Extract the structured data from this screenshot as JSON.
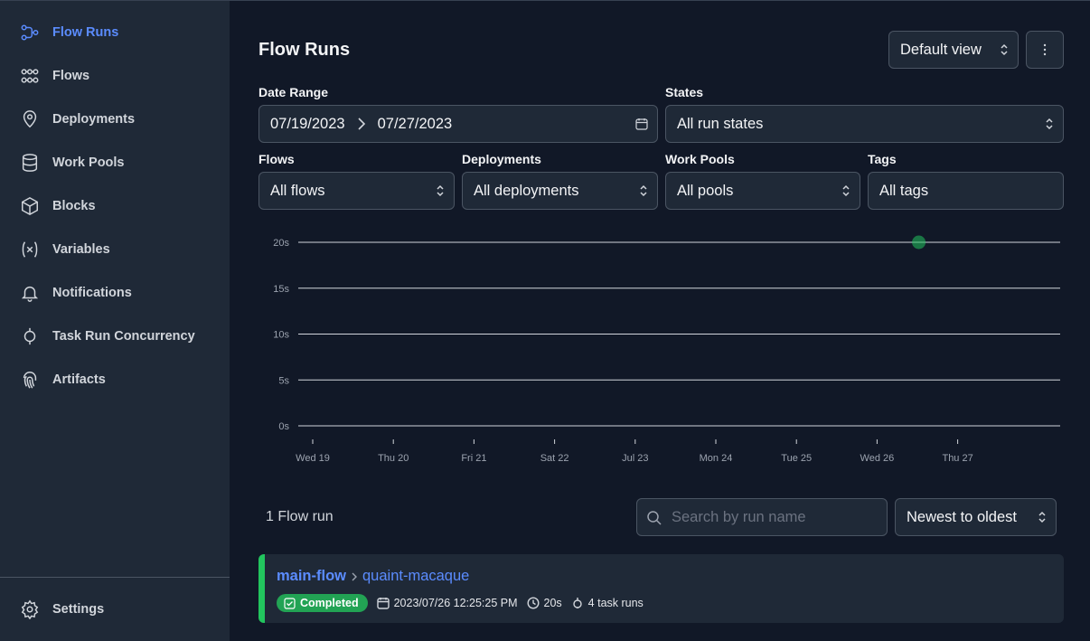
{
  "sidebar": {
    "items": [
      {
        "label": "Flow Runs",
        "icon": "flow-runs-icon",
        "active": true
      },
      {
        "label": "Flows",
        "icon": "flows-icon"
      },
      {
        "label": "Deployments",
        "icon": "map-pin-icon"
      },
      {
        "label": "Work Pools",
        "icon": "database-icon"
      },
      {
        "label": "Blocks",
        "icon": "cube-icon"
      },
      {
        "label": "Variables",
        "icon": "variable-icon"
      },
      {
        "label": "Notifications",
        "icon": "bell-icon"
      },
      {
        "label": "Task Run Concurrency",
        "icon": "concurrency-icon"
      },
      {
        "label": "Artifacts",
        "icon": "fingerprint-icon"
      }
    ],
    "settings_label": "Settings"
  },
  "header": {
    "title": "Flow Runs",
    "view_select": "Default view"
  },
  "filters": {
    "date_range": {
      "label": "Date Range",
      "start": "07/19/2023",
      "end": "07/27/2023"
    },
    "states": {
      "label": "States",
      "value": "All run states"
    },
    "flows": {
      "label": "Flows",
      "value": "All flows"
    },
    "deployments": {
      "label": "Deployments",
      "value": "All deployments"
    },
    "work_pools": {
      "label": "Work Pools",
      "value": "All pools"
    },
    "tags": {
      "label": "Tags",
      "value": "All tags"
    }
  },
  "chart_data": {
    "type": "scatter",
    "categories": [
      "Wed 19",
      "Thu 20",
      "Fri 21",
      "Sat 22",
      "Jul 23",
      "Mon 24",
      "Tue 25",
      "Wed 26",
      "Thu 27"
    ],
    "y_ticks": [
      "0s",
      "5s",
      "10s",
      "15s",
      "20s"
    ],
    "ylim": [
      0,
      20
    ],
    "points": [
      {
        "x": "2023-07-26 12:25:25",
        "y": 20,
        "state": "Completed"
      }
    ],
    "grid": true,
    "colors": {
      "completed": "#22c55e"
    }
  },
  "runs_list": {
    "count_text": "1 Flow run",
    "search_placeholder": "Search by run name",
    "sort_value": "Newest to oldest",
    "runs": [
      {
        "flow_name": "main-flow",
        "run_name": "quaint-macaque",
        "state": "Completed",
        "start_time": "2023/07/26 12:25:25 PM",
        "duration": "20s",
        "task_runs": "4 task runs"
      }
    ]
  },
  "colors": {
    "accent": "#5b8cff",
    "completed": "#22c55e",
    "background": "#111827",
    "sidebar": "#1f2937"
  }
}
